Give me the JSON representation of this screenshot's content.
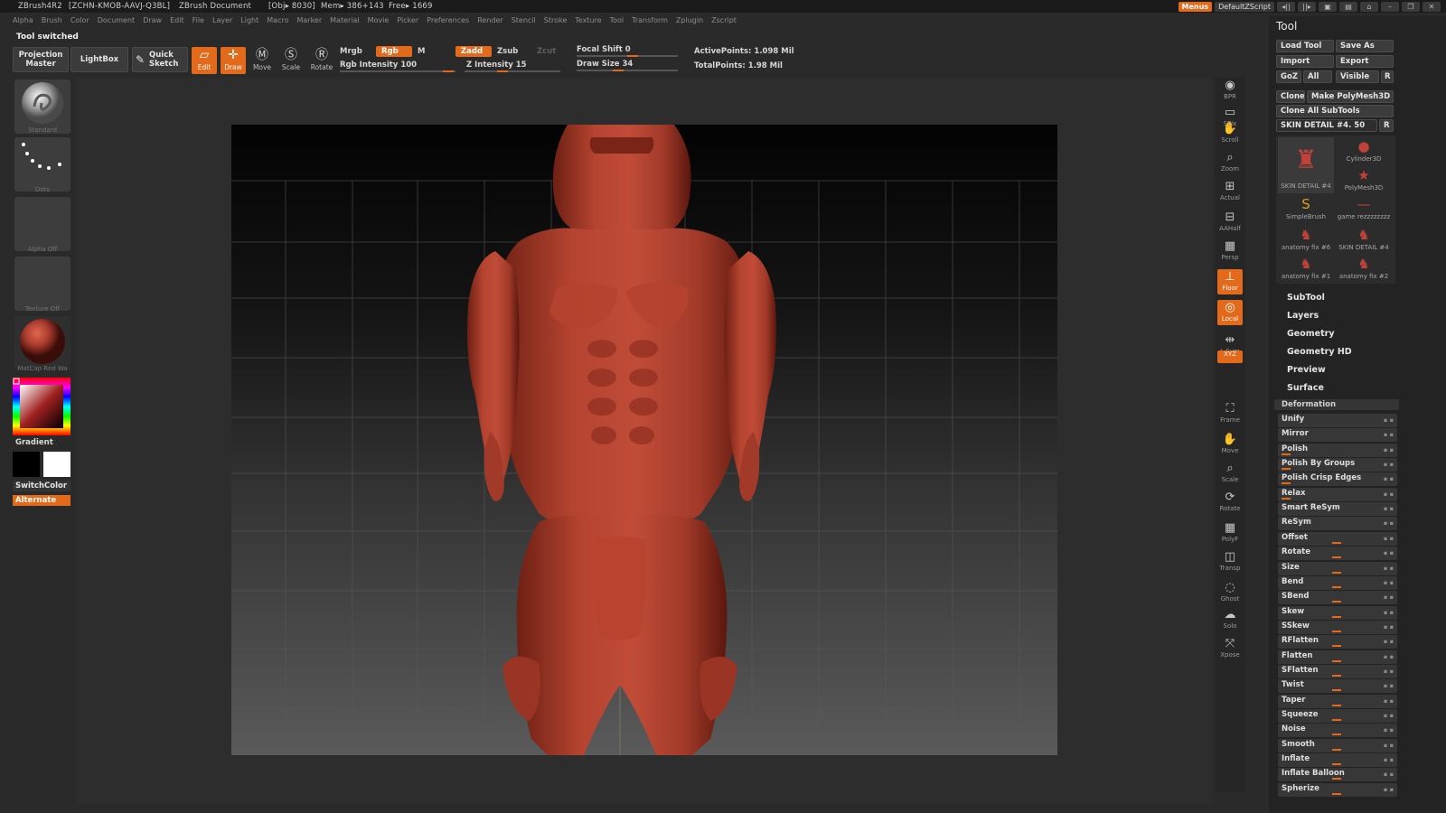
{
  "titlebar": {
    "app": "ZBrush4R2",
    "license": "[ZCHN-KMOB-AAVJ-Q3BL]",
    "document": "ZBrush Document",
    "obj": "[Obj▸ 8030]",
    "mem": "Mem▸ 386+143",
    "free": "Free▸ 1669",
    "menus_label": "Menus",
    "zscript_label": "DefaultZScript"
  },
  "menubar": [
    "Alpha",
    "Brush",
    "Color",
    "Document",
    "Draw",
    "Edit",
    "File",
    "Layer",
    "Light",
    "Macro",
    "Marker",
    "Material",
    "Movie",
    "Picker",
    "Preferences",
    "Render",
    "Stencil",
    "Stroke",
    "Texture",
    "Tool",
    "Transform",
    "Zplugin",
    "Zscript"
  ],
  "status_message": "Tool switched",
  "toolbar": {
    "projection_master": "Projection Master",
    "lightbox": "LightBox",
    "quick_sketch": "Quick Sketch",
    "edit": "Edit",
    "draw": "Draw",
    "move": "Move",
    "scale": "Scale",
    "rotate": "Rotate",
    "mrgb": "Mrgb",
    "rgb": "Rgb",
    "m": "M",
    "rgb_intensity_label": "Rgb Intensity",
    "rgb_intensity": "100",
    "zadd": "Zadd",
    "zsub": "Zsub",
    "zcut": "Zcut",
    "z_intensity_label": "Z Intensity",
    "z_intensity": "15",
    "focal_shift_label": "Focal Shift",
    "focal_shift": "0",
    "draw_size_label": "Draw Size",
    "draw_size": "34",
    "active_points": "ActivePoints: 1.098 Mil",
    "total_points": "TotalPoints: 1.98 Mil"
  },
  "left_palette": {
    "brush_label": "Standard",
    "stroke_label": "Dots",
    "alpha_label": "Alpha Off",
    "texture_label": "Texture Off",
    "material_label": "MatCap Red Wa",
    "gradient_label": "Gradient",
    "switchcolor_label": "SwitchColor",
    "alternate_label": "Alternate"
  },
  "shelf": [
    {
      "label": "BPR",
      "icon": "bpr-icon"
    },
    {
      "label": "SPix",
      "icon": "spix-icon"
    },
    {
      "label": "Scroll",
      "icon": "scroll-icon"
    },
    {
      "label": "Zoom",
      "icon": "zoom-icon"
    },
    {
      "label": "Actual",
      "icon": "actual-icon"
    },
    {
      "label": "AAHalf",
      "icon": "aahalf-icon"
    },
    {
      "label": "Persp",
      "icon": "persp-icon"
    },
    {
      "label": "Floor",
      "icon": "floor-icon"
    },
    {
      "label": "Local",
      "icon": "local-icon"
    },
    {
      "label": "L.Sym",
      "icon": "lsym-icon"
    },
    {
      "label": "XYZ",
      "icon": "xyz-icon"
    },
    {
      "label": "Frame",
      "icon": "frame-icon"
    },
    {
      "label": "Move",
      "icon": "move-icon"
    },
    {
      "label": "Scale",
      "icon": "scale-icon"
    },
    {
      "label": "Rotate",
      "icon": "rotate-icon"
    },
    {
      "label": "PolyF",
      "icon": "polyf-icon"
    },
    {
      "label": "Transp",
      "icon": "transp-icon"
    },
    {
      "label": "Ghost",
      "icon": "ghost-icon"
    },
    {
      "label": "Solo",
      "icon": "solo-icon"
    },
    {
      "label": "Xpose",
      "icon": "xpose-icon"
    }
  ],
  "tool": {
    "title": "Tool",
    "load_tool": "Load Tool",
    "save_as": "Save As",
    "import": "Import",
    "export": "Export",
    "goz": "GoZ",
    "all": "All",
    "visible": "Visible",
    "r": "R",
    "clone": "Clone",
    "make_polymesh": "Make PolyMesh3D",
    "clone_all": "Clone All SubTools",
    "current_tool": "SKIN DETAIL #4. 50",
    "thumbnails": [
      {
        "label": "SKIN DETAIL #4"
      },
      {
        "label": "Cylinder3D"
      },
      {
        "label": "PolyMesh3D"
      },
      {
        "label": "SimpleBrush"
      },
      {
        "label": "game rezzzzzzzz"
      },
      {
        "label": "anatomy fix #6"
      },
      {
        "label": "SKIN DETAIL #4"
      },
      {
        "label": "anatomy fix #1"
      },
      {
        "label": "anatomy fix #2"
      }
    ],
    "sections": [
      "SubTool",
      "Layers",
      "Geometry",
      "Geometry HD",
      "Preview",
      "Surface"
    ],
    "deformation_title": "Deformation",
    "deformation_items": [
      "Unify",
      "Mirror",
      "Polish",
      "Polish By Groups",
      "Polish Crisp Edges",
      "Relax",
      "Smart ReSym",
      "ReSym",
      "Offset",
      "Rotate",
      "Size",
      "Bend",
      "SBend",
      "Skew",
      "SSkew",
      "RFlatten",
      "Flatten",
      "SFlatten",
      "Twist",
      "Taper",
      "Squeeze",
      "Noise",
      "Smooth",
      "Inflate",
      "Inflate Balloon",
      "Spherize"
    ]
  },
  "colors": {
    "accent": "#e36a1a",
    "model": "#a8392c",
    "bg": "#2a2a2a"
  }
}
